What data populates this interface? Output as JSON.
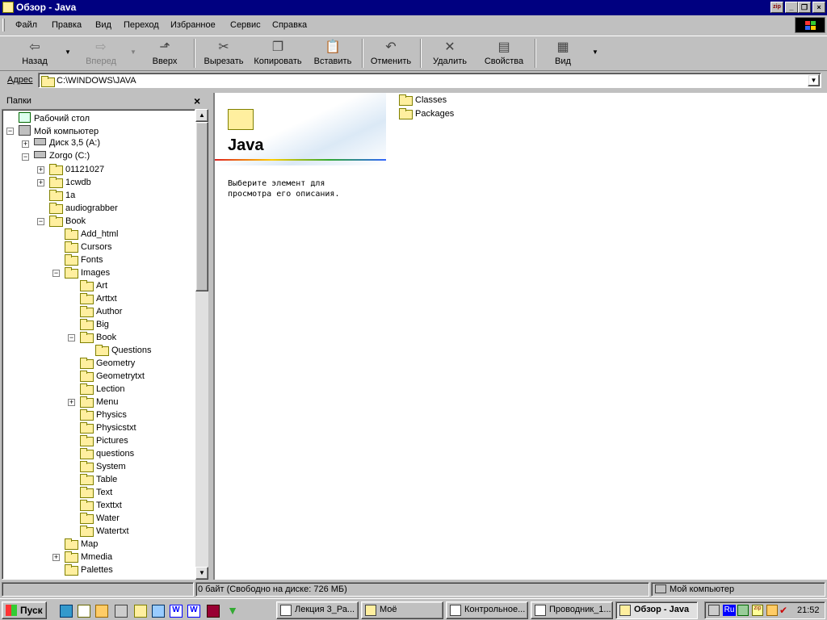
{
  "window": {
    "title": "Обзор - Java"
  },
  "menu": [
    "Файл",
    "Правка",
    "Вид",
    "Переход",
    "Избранное",
    "Сервис",
    "Справка"
  ],
  "toolbar": {
    "back": "Назад",
    "forward": "Вперед",
    "up": "Вверх",
    "cut": "Вырезать",
    "copy": "Копировать",
    "paste": "Вставить",
    "undo": "Отменить",
    "delete": "Удалить",
    "properties": "Свойства",
    "view": "Вид"
  },
  "address": {
    "label": "Адрес",
    "value": "C:\\WINDOWS\\JAVA"
  },
  "folders_pane": {
    "title": "Папки"
  },
  "tree": [
    {
      "label": "Рабочий стол",
      "level": 0
    },
    {
      "label": "Мой компьютер",
      "level": 0
    },
    {
      "label": "Диск 3,5 (A:)",
      "level": 1
    },
    {
      "label": "Zorgo (C:)",
      "level": 1
    },
    {
      "label": "01121027",
      "level": 2
    },
    {
      "label": "1cwdb",
      "level": 2
    },
    {
      "label": "1a",
      "level": 2
    },
    {
      "label": "audiograbber",
      "level": 2
    },
    {
      "label": "Book",
      "level": 2
    },
    {
      "label": "Add_html",
      "level": 3
    },
    {
      "label": "Cursors",
      "level": 3
    },
    {
      "label": "Fonts",
      "level": 3
    },
    {
      "label": "Images",
      "level": 3
    },
    {
      "label": "Art",
      "level": 4
    },
    {
      "label": "Arttxt",
      "level": 4
    },
    {
      "label": "Author",
      "level": 4
    },
    {
      "label": "Big",
      "level": 4
    },
    {
      "label": "Book",
      "level": 4
    },
    {
      "label": "Questions",
      "level": 5
    },
    {
      "label": "Geometry",
      "level": 4
    },
    {
      "label": "Geometrytxt",
      "level": 4
    },
    {
      "label": "Lection",
      "level": 4
    },
    {
      "label": "Menu",
      "level": 4
    },
    {
      "label": "Physics",
      "level": 4
    },
    {
      "label": "Physicstxt",
      "level": 4
    },
    {
      "label": "Pictures",
      "level": 4
    },
    {
      "label": "questions",
      "level": 4
    },
    {
      "label": "System",
      "level": 4
    },
    {
      "label": "Table",
      "level": 4
    },
    {
      "label": "Text",
      "level": 4
    },
    {
      "label": "Texttxt",
      "level": 4
    },
    {
      "label": "Water",
      "level": 4
    },
    {
      "label": "Watertxt",
      "level": 4
    },
    {
      "label": "Map",
      "level": 3
    },
    {
      "label": "Mmedia",
      "level": 3
    },
    {
      "label": "Palettes",
      "level": 3
    }
  ],
  "content": {
    "folder_title": "Java",
    "hint": [
      "Выберите элемент для",
      "просмотра его описания."
    ],
    "items": [
      "Classes",
      "Packages"
    ]
  },
  "status": {
    "left": "0 байт (Свободно на диске: 726 МБ)",
    "right": "Мой компьютер"
  },
  "taskbar": {
    "start": "Пуск",
    "tasks": [
      "Лекция 3_Ра...",
      "Моё",
      "Контрольное...",
      "Проводник_1...",
      "Обзор - Java"
    ],
    "lang": "Ru",
    "clock": "21:52"
  }
}
